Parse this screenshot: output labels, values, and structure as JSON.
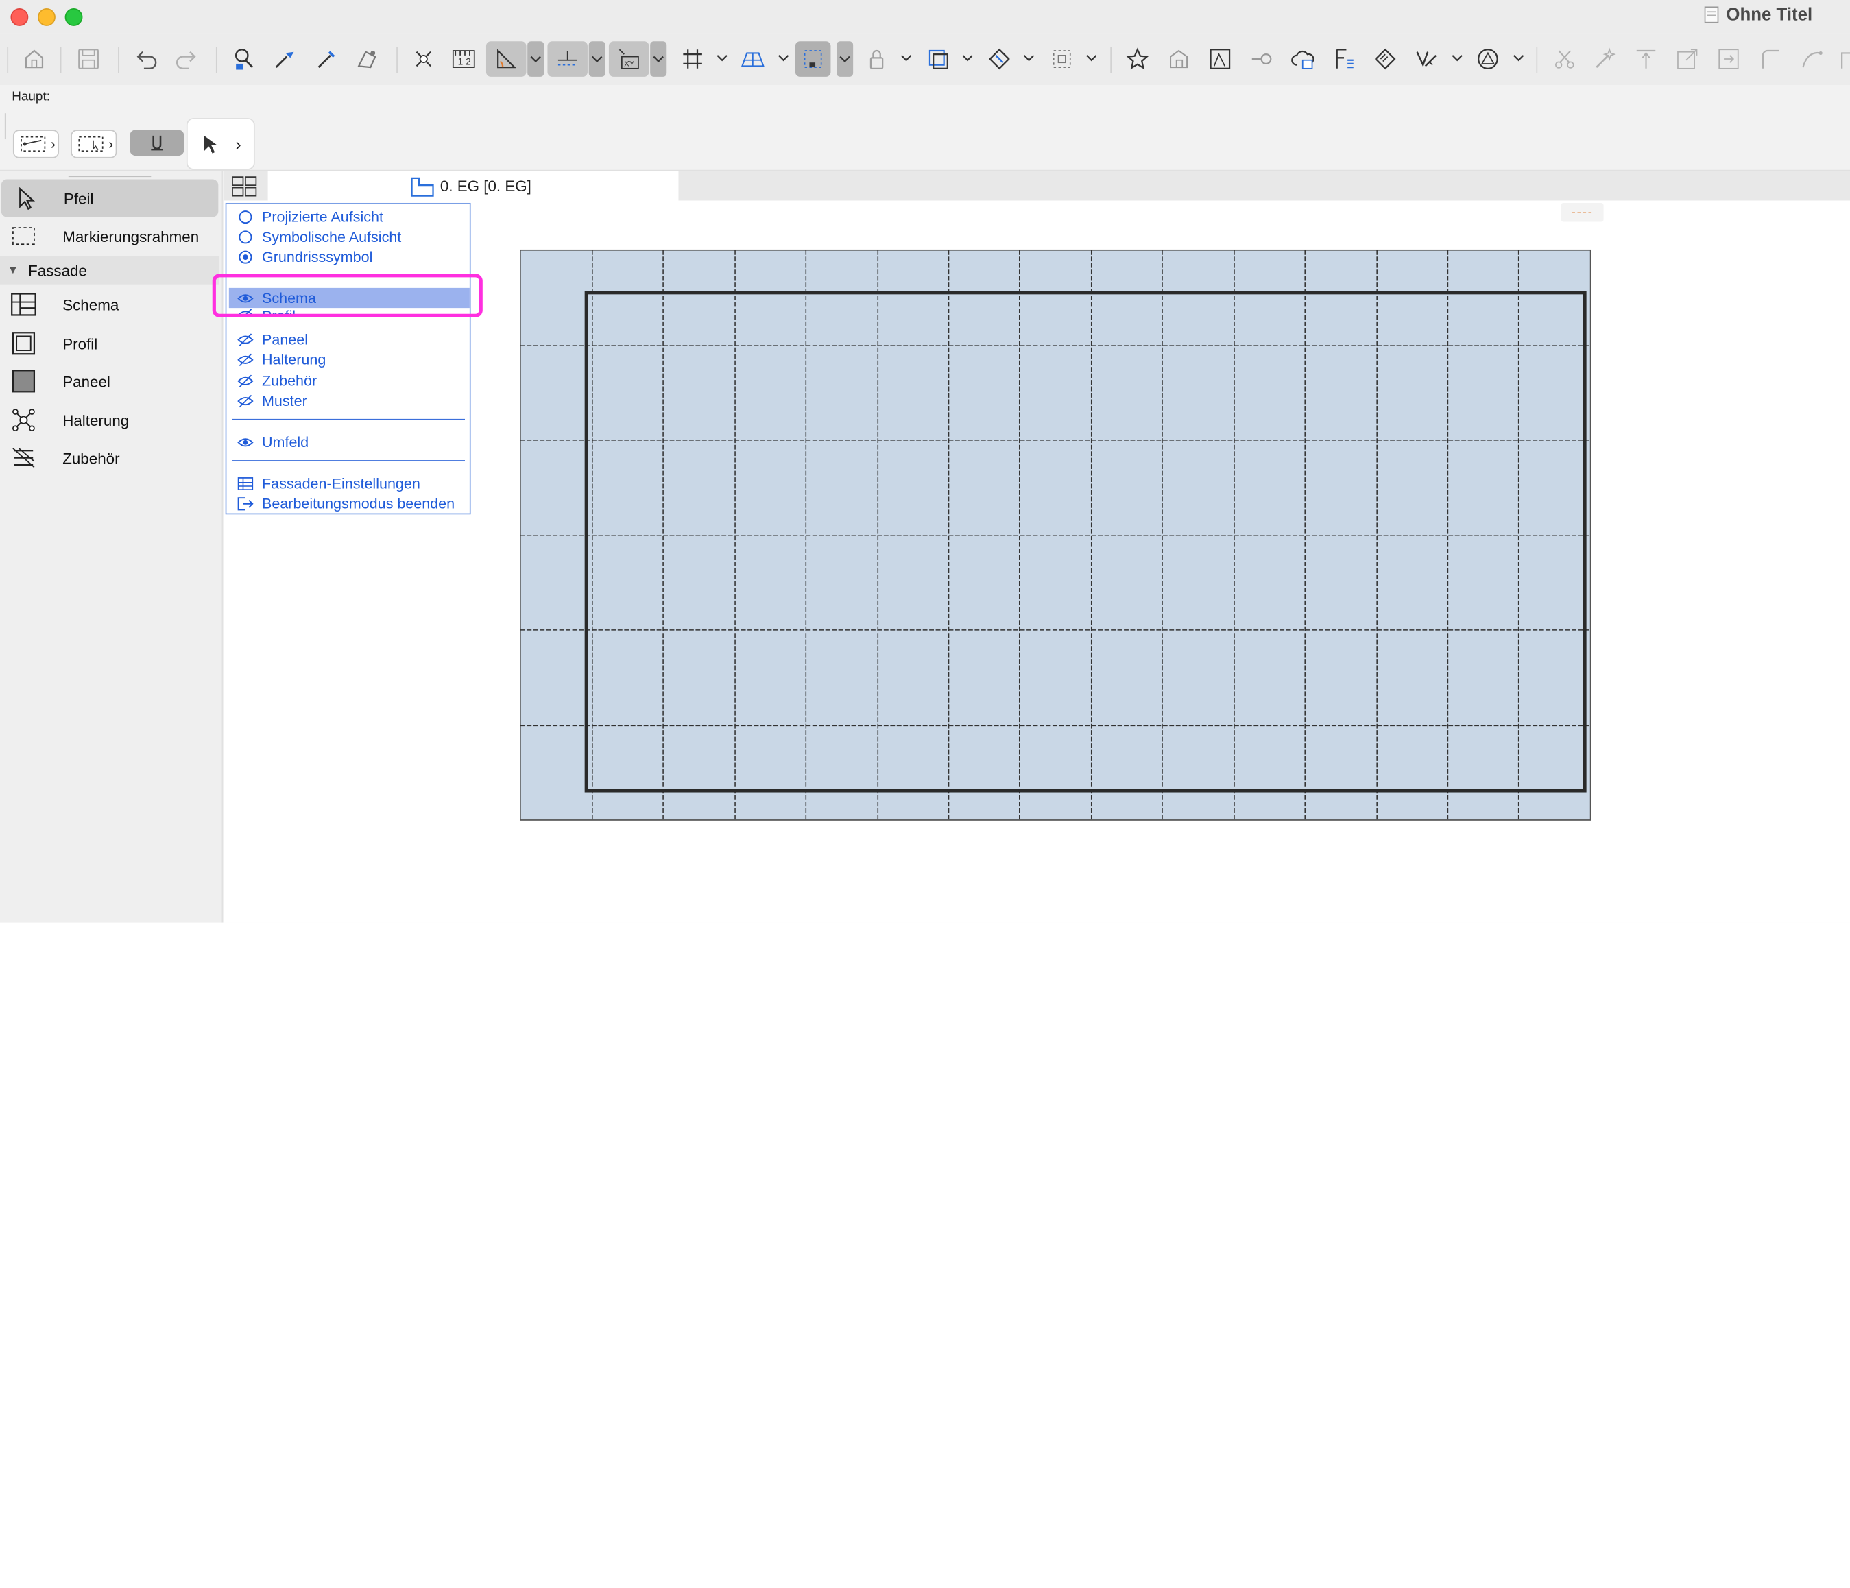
{
  "window": {
    "title": "Ohne Titel"
  },
  "infobox": {
    "label": "Haupt:"
  },
  "toolbox": {
    "arrow_label": "Pfeil",
    "marquee_label": "Markierungsrahmen",
    "group_label": "Fassade",
    "items": [
      {
        "label": "Schema",
        "icon": "schema-icon"
      },
      {
        "label": "Profil",
        "icon": "profile-icon"
      },
      {
        "label": "Paneel",
        "icon": "panel-icon"
      },
      {
        "label": "Halterung",
        "icon": "bracket-icon"
      },
      {
        "label": "Zubehör",
        "icon": "accessory-icon"
      }
    ]
  },
  "tab": {
    "label": "0. EG [0. EG]"
  },
  "scale_indicator": "----",
  "menu": {
    "view_options": [
      "Projizierte Aufsicht",
      "Symbolische Aufsicht",
      "Grundrisssymbol"
    ],
    "selected_view": "Grundrisssymbol",
    "visibility": [
      {
        "label": "Schema",
        "visible": true
      },
      {
        "label": "Profil",
        "visible": false
      },
      {
        "label": "Paneel",
        "visible": false
      },
      {
        "label": "Halterung",
        "visible": false
      },
      {
        "label": "Zubehör",
        "visible": false
      },
      {
        "label": "Muster",
        "visible": false
      }
    ],
    "umfeld": {
      "label": "Umfeld",
      "visible": true
    },
    "settings_label": "Fassaden-Einstellungen",
    "exit_label": "Bearbeitungsmodus beenden"
  },
  "colors": {
    "menu_text": "#1f5bd9",
    "menu_highlight": "#9bb2ee",
    "annotation": "#ff2fe0",
    "panel_fill": "#c9d7e6"
  }
}
